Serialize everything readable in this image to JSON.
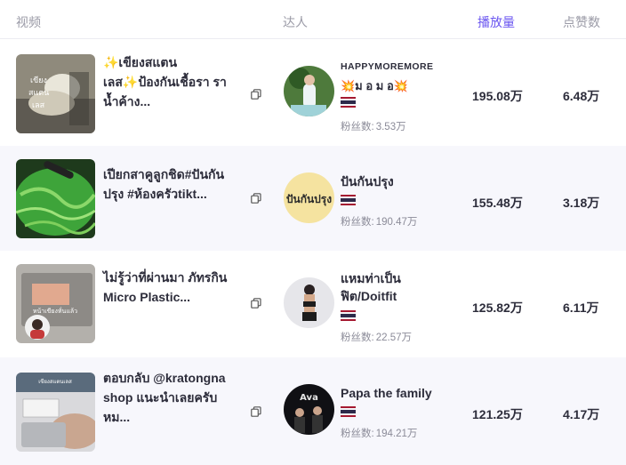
{
  "header": {
    "video": "视频",
    "creator": "达人",
    "plays": "播放量",
    "likes": "点赞数"
  },
  "fans_label": "粉丝数:",
  "rows": [
    {
      "title": "✨เขียงสแตน\nเลส✨ป้องกันเชื้อรา รา\nน้ำค้าง...",
      "creator_name": "HAPPYMOREMORE",
      "creator_sub": "💥ม อ ม อ💥",
      "fans": "3.53万",
      "plays": "195.08万",
      "likes": "6.48万",
      "thumb_text": "เขียง สแตน เลส"
    },
    {
      "title": "เปียกสาคูลูกชิด#ปันกัน\nปรุง #ห้องครัวtikt...",
      "creator_name": "ปันกันปรุง",
      "fans": "190.47万",
      "plays": "155.48万",
      "likes": "3.18万",
      "avatar_text": "ปันกันปรุง"
    },
    {
      "title": "ไม่รู้ว่าที่ผ่านมา ภัทรกิน\nMicro Plastic...",
      "creator_name": "แหมท่าเป็น\nฟิต/Doitfit",
      "fans": "22.57万",
      "plays": "125.82万",
      "likes": "6.11万",
      "thumb_text": "หน้าเขียงหั่นแล้ว"
    },
    {
      "title": "ตอบกลับ @kratongna\nshop แนะนำเลยครับ\nหม...",
      "creator_name": "Papa the family",
      "fans": "194.21万",
      "plays": "121.25万",
      "likes": "4.17万"
    }
  ],
  "colors": {
    "accent": "#6a55f0",
    "row_alt": "#f7f7fc",
    "muted": "#8b8b98"
  },
  "icons": [
    "copy-icon",
    "thailand-flag-icon"
  ]
}
